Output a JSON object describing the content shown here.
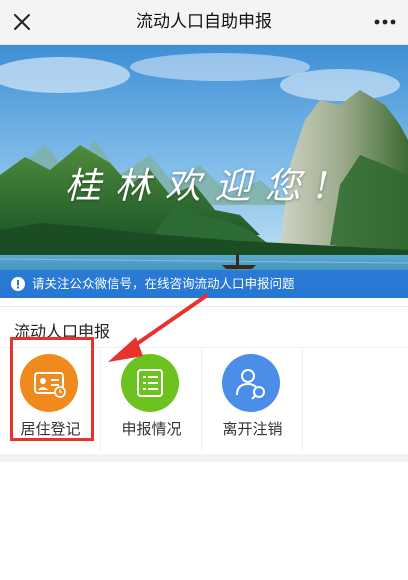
{
  "header": {
    "title": "流动人口自助申报",
    "close_icon": "close-icon",
    "more_icon": "more-icon"
  },
  "banner": {
    "caption": "桂林欢迎您!",
    "notice_text": "请关注公众微信号，在线咨询流动人口申报问题",
    "notice_icon": "info-icon",
    "notice_color": "#2878d7"
  },
  "section": {
    "title": "流动人口申报",
    "items": [
      {
        "label": "居住登记",
        "icon": "id-card-icon",
        "color": "#f08a1c"
      },
      {
        "label": "申报情况",
        "icon": "list-icon",
        "color": "#6cc21e"
      },
      {
        "label": "离开注销",
        "icon": "user-exit-icon",
        "color": "#4a8ee8"
      }
    ]
  },
  "annotation": {
    "highlight_color": "#e8322e"
  }
}
